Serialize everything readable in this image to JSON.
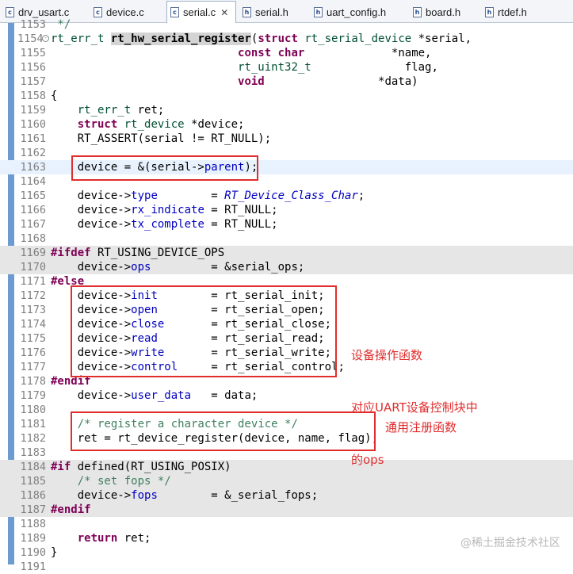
{
  "tabs": [
    {
      "label": "drv_usart.c",
      "icon": "c-file-icon",
      "icon_glyph": "c"
    },
    {
      "label": "device.c",
      "icon": "c-file-icon",
      "icon_glyph": "c"
    },
    {
      "label": "serial.c",
      "icon": "c-file-icon",
      "icon_glyph": "c",
      "active": true,
      "close": "✕"
    },
    {
      "label": "serial.h",
      "icon": "h-file-icon",
      "icon_glyph": "h"
    },
    {
      "label": "uart_config.h",
      "icon": "h-file-icon",
      "icon_glyph": "h"
    },
    {
      "label": "board.h",
      "icon": "h-file-icon",
      "icon_glyph": "h"
    },
    {
      "label": "rtdef.h",
      "icon": "h-file-icon",
      "icon_glyph": "h"
    }
  ],
  "lines": [
    {
      "n": "1153",
      "code": [
        [
          "cm",
          " */"
        ]
      ]
    },
    {
      "n": "1154",
      "fold": "⊖",
      "code": [
        [
          "tp",
          "rt_err_t"
        ],
        [
          "",
          "",
          " "
        ],
        [
          "hl",
          "rt_hw_serial_register"
        ],
        [
          "",
          "("
        ],
        [
          "kw",
          "struct"
        ],
        [
          "",
          " "
        ],
        [
          "tp",
          "rt_serial_device"
        ],
        [
          "",
          " *serial,"
        ]
      ]
    },
    {
      "n": "1155",
      "code": [
        [
          "",
          "                            "
        ],
        [
          "kw",
          "const"
        ],
        [
          "",
          " "
        ],
        [
          "kw",
          "char"
        ],
        [
          "",
          "             *name,"
        ]
      ]
    },
    {
      "n": "1156",
      "code": [
        [
          "",
          "                            "
        ],
        [
          "tp",
          "rt_uint32_t"
        ],
        [
          "",
          "              flag,"
        ]
      ]
    },
    {
      "n": "1157",
      "code": [
        [
          "",
          "                            "
        ],
        [
          "kw",
          "void"
        ],
        [
          "",
          "                 *data)"
        ]
      ]
    },
    {
      "n": "1158",
      "code": [
        [
          "",
          "{"
        ]
      ]
    },
    {
      "n": "1159",
      "code": [
        [
          "",
          "    "
        ],
        [
          "tp",
          "rt_err_t"
        ],
        [
          "",
          " ret;"
        ]
      ]
    },
    {
      "n": "1160",
      "code": [
        [
          "",
          "    "
        ],
        [
          "kw",
          "struct"
        ],
        [
          "",
          " "
        ],
        [
          "tp",
          "rt_device"
        ],
        [
          "",
          " *device;"
        ]
      ]
    },
    {
      "n": "1161",
      "code": [
        [
          "",
          "    RT_ASSERT(serial != RT_NULL);"
        ]
      ]
    },
    {
      "n": "1162",
      "code": []
    },
    {
      "n": "1163",
      "current": true,
      "code": [
        [
          "",
          "    device = &(serial->"
        ],
        [
          "fd",
          "parent"
        ],
        [
          "",
          ");"
        ]
      ]
    },
    {
      "n": "1164",
      "code": []
    },
    {
      "n": "1165",
      "code": [
        [
          "",
          "    device->"
        ],
        [
          "fd",
          "type"
        ],
        [
          "",
          "        = "
        ],
        [
          "it",
          "RT_Device_Class_Char"
        ],
        [
          "",
          ";"
        ]
      ]
    },
    {
      "n": "1166",
      "code": [
        [
          "",
          "    device->"
        ],
        [
          "fd",
          "rx_indicate"
        ],
        [
          "",
          " = RT_NULL;"
        ]
      ]
    },
    {
      "n": "1167",
      "code": [
        [
          "",
          "    device->"
        ],
        [
          "fd",
          "tx_complete"
        ],
        [
          "",
          " = RT_NULL;"
        ]
      ]
    },
    {
      "n": "1168",
      "code": []
    },
    {
      "n": "1169",
      "shaded": true,
      "code": [
        [
          "kw",
          "#ifdef"
        ],
        [
          "",
          " RT_USING_DEVICE_OPS"
        ]
      ]
    },
    {
      "n": "1170",
      "shaded": true,
      "code": [
        [
          "",
          "    device->"
        ],
        [
          "fd",
          "ops"
        ],
        [
          "",
          "         = &serial_ops;"
        ]
      ]
    },
    {
      "n": "1171",
      "code": [
        [
          "kw",
          "#else"
        ]
      ]
    },
    {
      "n": "1172",
      "code": [
        [
          "",
          "    device->"
        ],
        [
          "fd",
          "init"
        ],
        [
          "",
          "        = rt_serial_init;"
        ]
      ]
    },
    {
      "n": "1173",
      "code": [
        [
          "",
          "    device->"
        ],
        [
          "fd",
          "open"
        ],
        [
          "",
          "        = rt_serial_open;"
        ]
      ]
    },
    {
      "n": "1174",
      "code": [
        [
          "",
          "    device->"
        ],
        [
          "fd",
          "close"
        ],
        [
          "",
          "       = rt_serial_close;"
        ]
      ]
    },
    {
      "n": "1175",
      "code": [
        [
          "",
          "    device->"
        ],
        [
          "fd",
          "read"
        ],
        [
          "",
          "        = rt_serial_read;"
        ]
      ]
    },
    {
      "n": "1176",
      "code": [
        [
          "",
          "    device->"
        ],
        [
          "fd",
          "write"
        ],
        [
          "",
          "       = rt_serial_write;"
        ]
      ]
    },
    {
      "n": "1177",
      "code": [
        [
          "",
          "    device->"
        ],
        [
          "fd",
          "control"
        ],
        [
          "",
          "     = rt_serial_control;"
        ]
      ]
    },
    {
      "n": "1178",
      "code": [
        [
          "kw",
          "#endif"
        ]
      ]
    },
    {
      "n": "1179",
      "code": [
        [
          "",
          "    device->"
        ],
        [
          "fd",
          "user_data"
        ],
        [
          "",
          "   = data;"
        ]
      ]
    },
    {
      "n": "1180",
      "code": []
    },
    {
      "n": "1181",
      "code": [
        [
          "",
          "    "
        ],
        [
          "cm",
          "/* register a character device */"
        ]
      ]
    },
    {
      "n": "1182",
      "code": [
        [
          "",
          "    ret = rt_device_register(device, name, flag);"
        ]
      ]
    },
    {
      "n": "1183",
      "code": []
    },
    {
      "n": "1184",
      "shaded": true,
      "code": [
        [
          "kw",
          "#if"
        ],
        [
          "",
          " defined(RT_USING_POSIX)"
        ]
      ]
    },
    {
      "n": "1185",
      "shaded": true,
      "code": [
        [
          "",
          "    "
        ],
        [
          "cm",
          "/* set fops */"
        ]
      ]
    },
    {
      "n": "1186",
      "shaded": true,
      "code": [
        [
          "",
          "    device->"
        ],
        [
          "fd",
          "fops"
        ],
        [
          "",
          "        = &_serial_fops;"
        ]
      ]
    },
    {
      "n": "1187",
      "shaded": true,
      "code": [
        [
          "kw",
          "#endif"
        ]
      ]
    },
    {
      "n": "1188",
      "code": []
    },
    {
      "n": "1189",
      "code": [
        [
          "",
          "    "
        ],
        [
          "kw",
          "return"
        ],
        [
          "",
          " ret;"
        ]
      ]
    },
    {
      "n": "1190",
      "code": [
        [
          "",
          "}"
        ]
      ]
    },
    {
      "n": "1191",
      "code": []
    }
  ],
  "annotations": {
    "ops_note_line1": "设备操作函数",
    "ops_note_line2": "对应UART设备控制块中",
    "ops_note_line3": "的ops",
    "register_note": "通用注册函数",
    "color": "#e02d2d"
  },
  "watermark": "@稀土掘金技术社区"
}
